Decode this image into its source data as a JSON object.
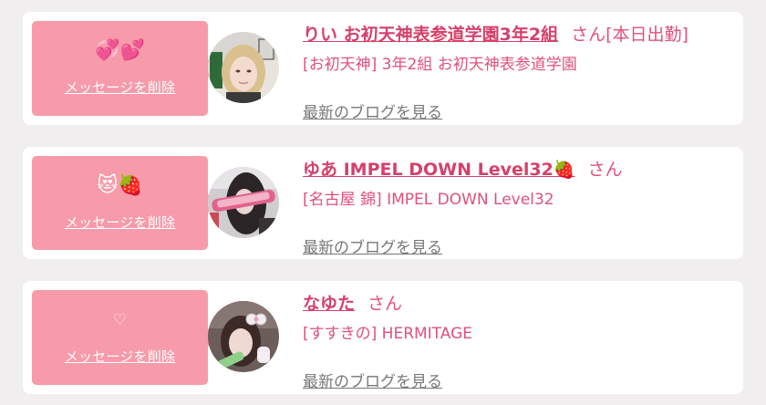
{
  "messages": [
    {
      "message_text": "💞💕",
      "delete_label": "メッセージを削除",
      "name": "りい お初天神表参道学園3年2組",
      "honorific": "さん",
      "status": "[本日出勤]",
      "shop": "[お初天神] 3年2組 お初天神表参道学園",
      "blog_link": "最新のブログを見る",
      "avatar_icon": "profile-photo"
    },
    {
      "message_text": "😻🍓",
      "delete_label": "メッセージを削除",
      "name": "ゆあ IMPEL DOWN Level32🍓",
      "honorific": "さん",
      "status": "",
      "shop": "[名古屋 錦] IMPEL DOWN Level32",
      "blog_link": "最新のブログを見る",
      "avatar_icon": "profile-photo"
    },
    {
      "message_text": "♡",
      "delete_label": "メッセージを削除",
      "name": "なゆた",
      "honorific": "さん",
      "status": "",
      "shop": "[すすきの] HERMITAGE",
      "blog_link": "最新のブログを見る",
      "avatar_icon": "profile-photo"
    }
  ],
  "colors": {
    "bubble": "#f79aa9",
    "name": "#d6406a",
    "text_pink": "#e0517a",
    "link_gray": "#777777",
    "background": "#f0eeef"
  }
}
